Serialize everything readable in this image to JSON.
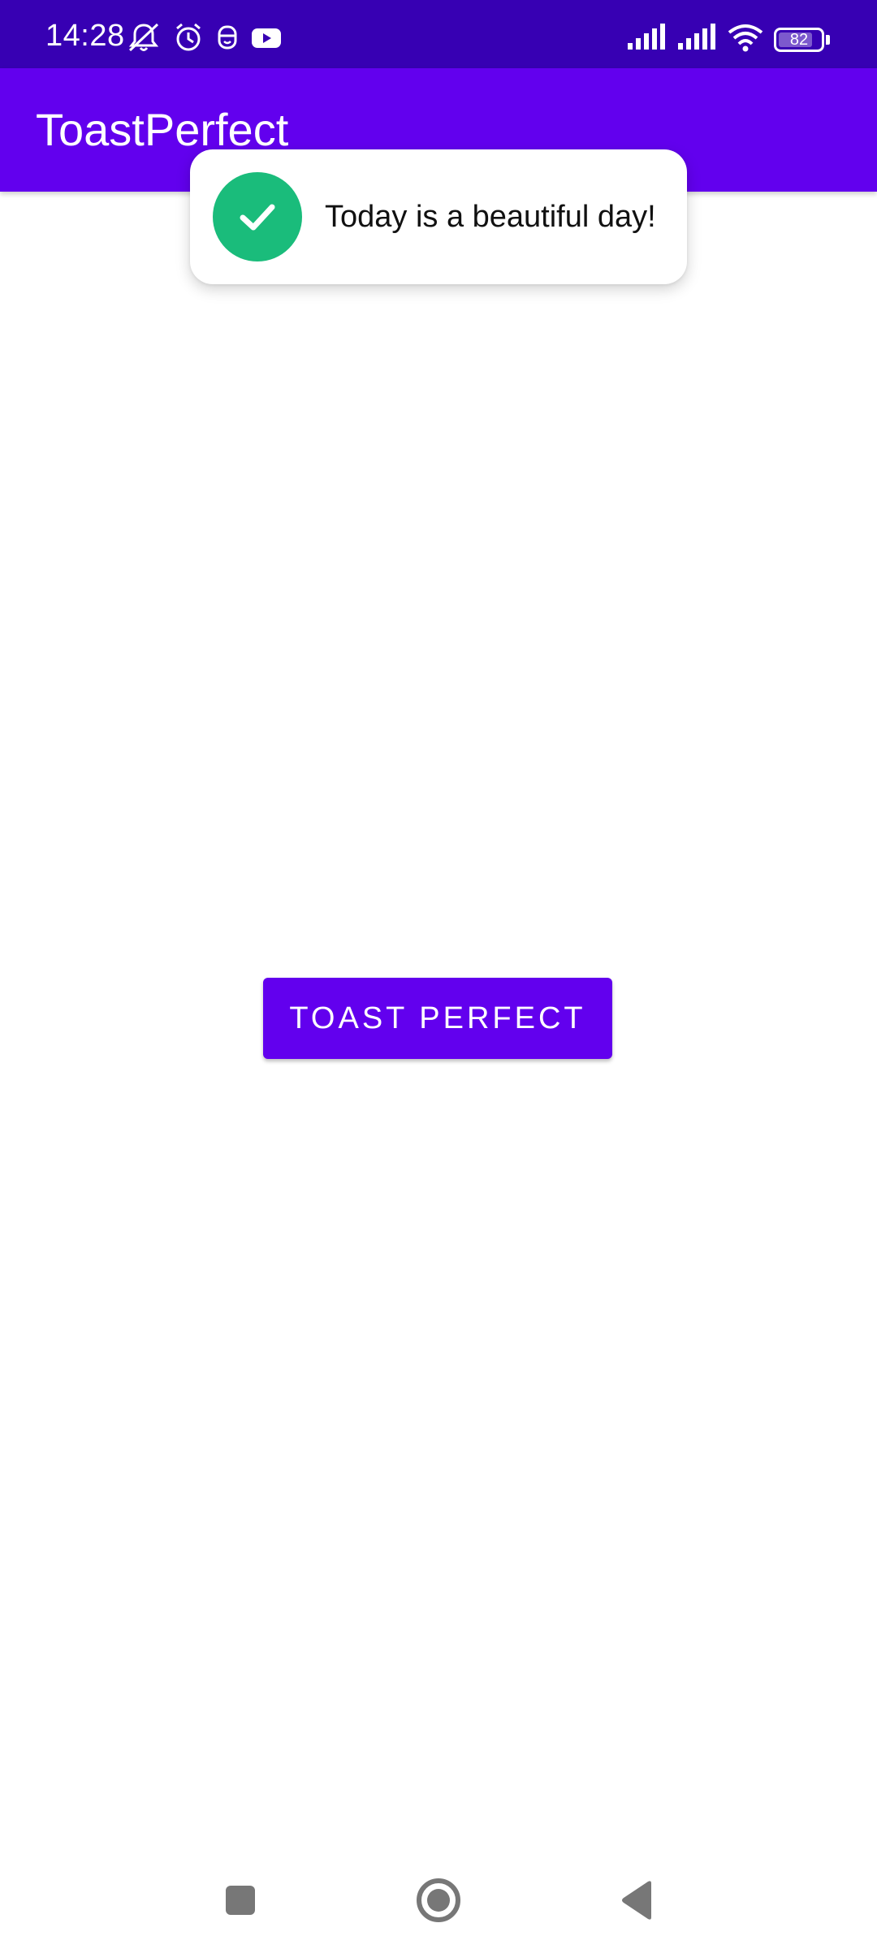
{
  "status_bar": {
    "time": "14:28",
    "battery_level": "82",
    "battery_fraction": 0.82,
    "left_icons": [
      "notifications-off-icon",
      "alarm-icon",
      "face-icon",
      "youtube-icon"
    ],
    "right_icons": [
      "signal-icon",
      "signal-icon",
      "wifi-icon",
      "battery-icon"
    ]
  },
  "app_bar": {
    "title": "ToastPerfect"
  },
  "toast": {
    "message": "Today is a beautiful day!",
    "icon": "check-icon",
    "icon_color": "#1abc7b"
  },
  "main": {
    "button_label": "TOAST PERFECT"
  },
  "nav_bar": {
    "items": [
      "recents-icon",
      "home-icon",
      "back-icon"
    ]
  },
  "colors": {
    "status_bar": "#3700b3",
    "primary": "#6200ee",
    "background": "#ffffff"
  }
}
